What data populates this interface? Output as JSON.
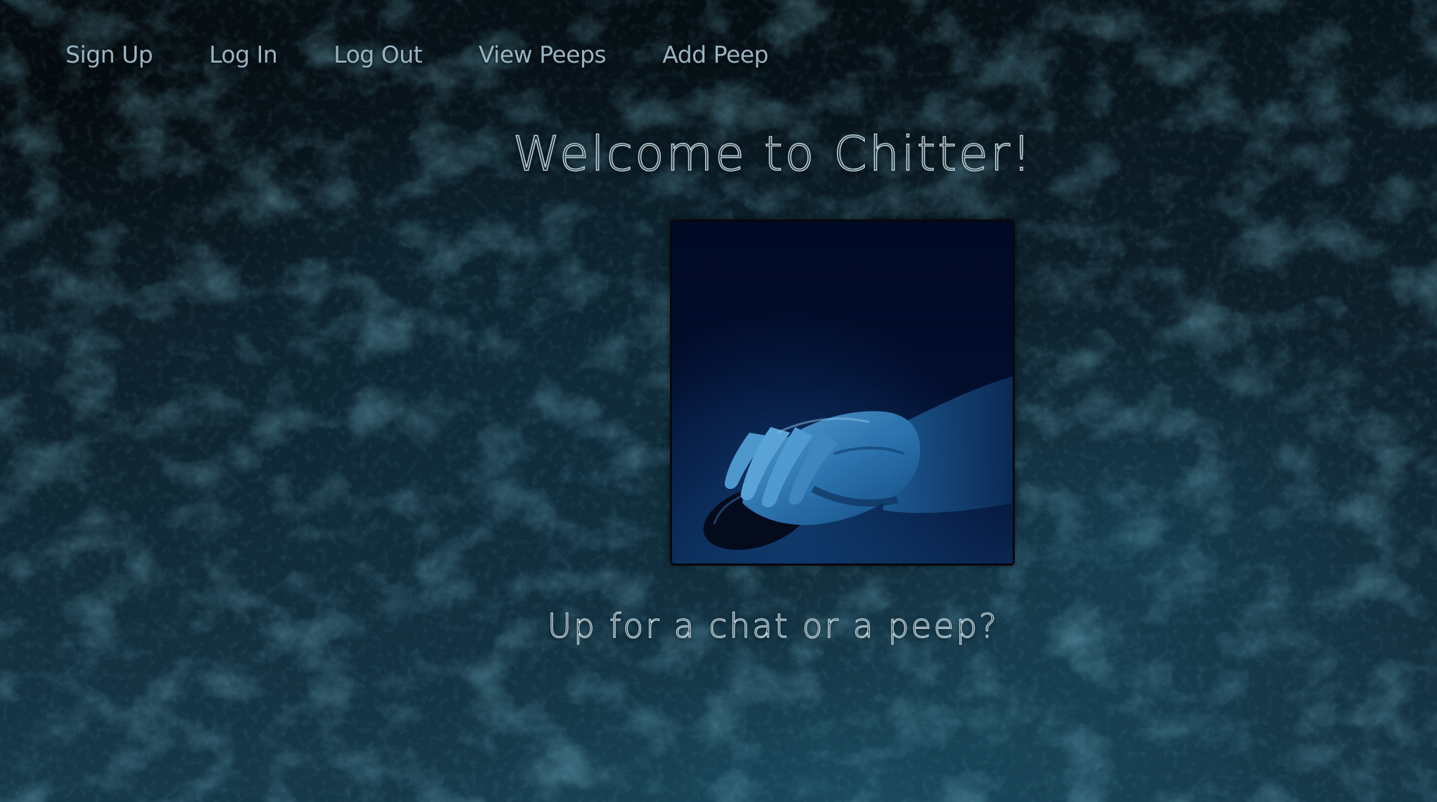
{
  "nav": {
    "items": [
      {
        "label": "Sign Up"
      },
      {
        "label": "Log In"
      },
      {
        "label": "Log Out"
      },
      {
        "label": "View Peeps"
      },
      {
        "label": "Add Peep"
      }
    ]
  },
  "main": {
    "title": "Welcome to Chitter!",
    "tagline": "Up for a chat or a peep?",
    "hero_image": "hand-on-computer-mouse"
  },
  "colors": {
    "background": "#0c1c25",
    "nav_text": "#98b4c2",
    "heading_outline": "#b8cfd8",
    "hero_bg": "#010a26"
  }
}
